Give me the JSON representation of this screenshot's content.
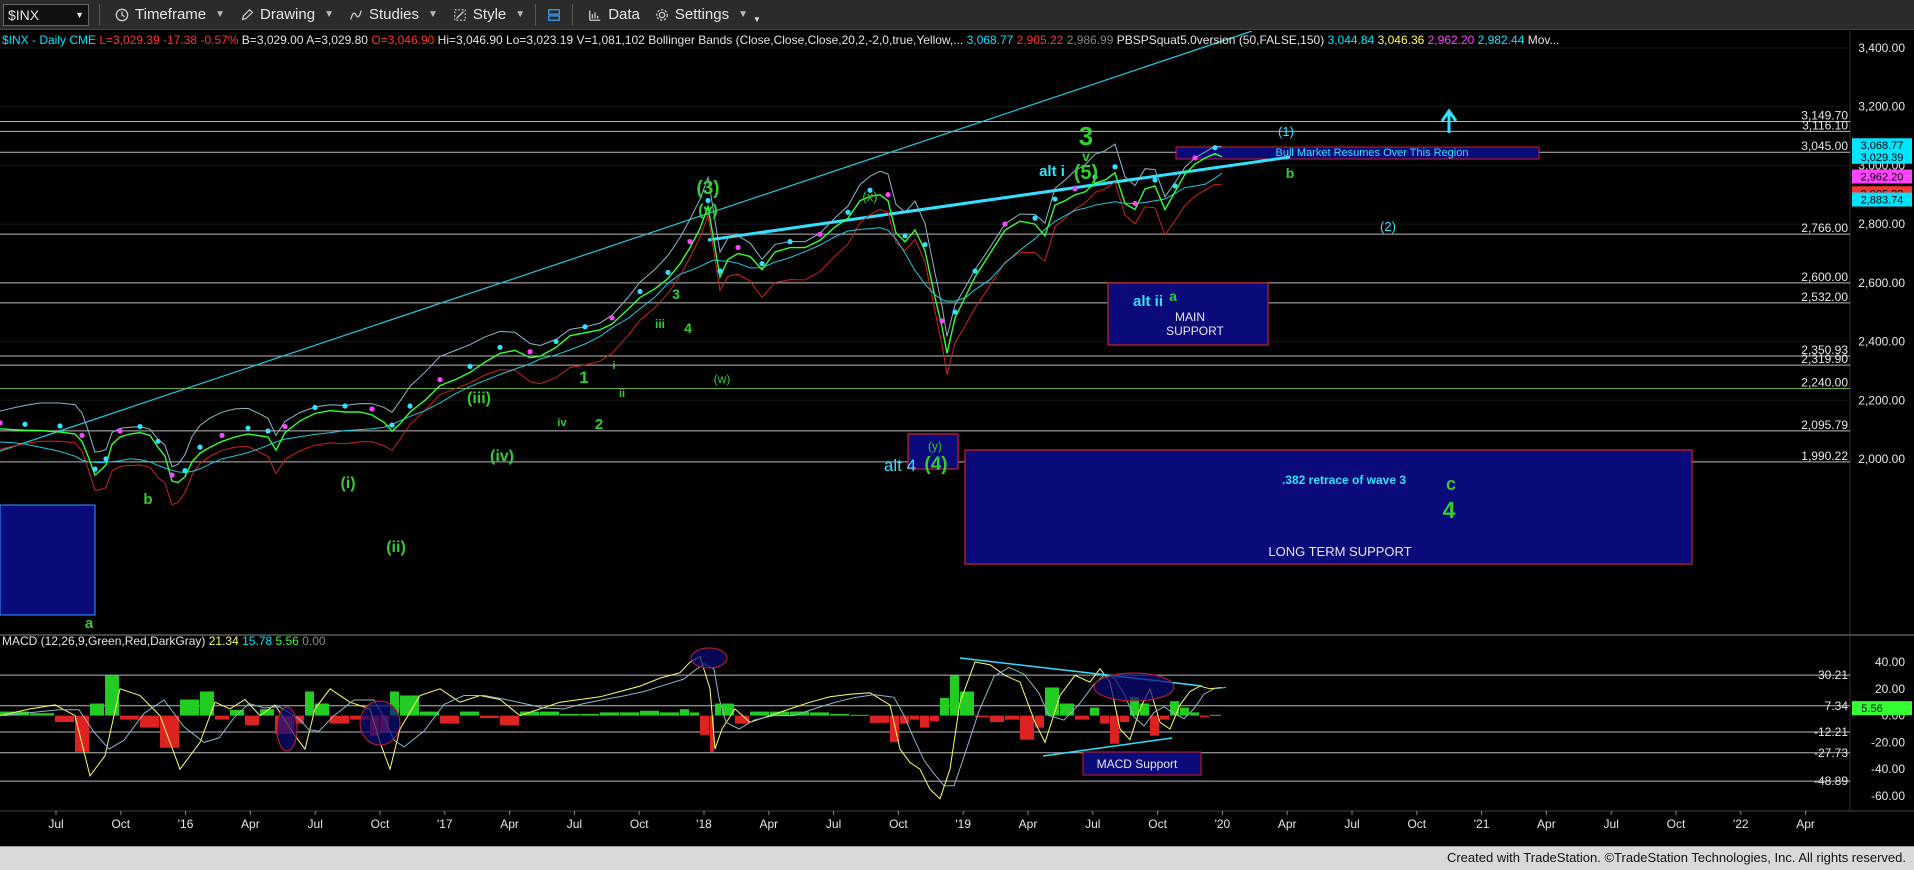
{
  "toolbar": {
    "symbol": "$INX",
    "timeframe": "Timeframe",
    "drawing": "Drawing",
    "studies": "Studies",
    "style": "Style",
    "data": "Data",
    "settings": "Settings"
  },
  "legend": {
    "items": [
      {
        "text": "$INX - Daily",
        "color": "#00e5ff"
      },
      {
        "text": "CME",
        "color": "#00e5ff"
      },
      {
        "text": "L=3,029.39",
        "color": "#ff3333"
      },
      {
        "text": "-17.38",
        "color": "#ff3333"
      },
      {
        "text": "-0.57%",
        "color": "#ff3333"
      },
      {
        "text": "B=3,029.00",
        "color": "#e6e6e6"
      },
      {
        "text": "A=3,029.80",
        "color": "#e6e6e6"
      },
      {
        "text": "O=3,046.90",
        "color": "#ff3333"
      },
      {
        "text": "Hi=3,046.90",
        "color": "#e6e6e6"
      },
      {
        "text": "Lo=3,023.19",
        "color": "#e6e6e6"
      },
      {
        "text": "V=1,081,102",
        "color": "#e6e6e6"
      },
      {
        "text": "Bollinger Bands (Close,Close,Close,20,2,-2,0,true,Yellow,...",
        "color": "#e6e6e6"
      },
      {
        "text": "3,068.77",
        "color": "#00e5ff"
      },
      {
        "text": "2,905.22",
        "color": "#ff3333"
      },
      {
        "text": "2,986.99",
        "color": "#888888"
      },
      {
        "text": "PBSPSquat5.0version (50,FALSE,150)",
        "color": "#e6e6e6"
      },
      {
        "text": "3,044.84",
        "color": "#00e5ff"
      },
      {
        "text": "3,046.36",
        "color": "#ffff66"
      },
      {
        "text": "2,962.20",
        "color": "#ff44ff"
      },
      {
        "text": "2,982.44",
        "color": "#00e5ff"
      },
      {
        "text": "Mov...",
        "color": "#e6e6e6"
      }
    ]
  },
  "macd_legend": {
    "items": [
      {
        "text": "MACD (12,26,9,Green,Red,DarkGray)",
        "color": "#e6e6e6"
      },
      {
        "text": "21.34",
        "color": "#ffff66"
      },
      {
        "text": "15.78",
        "color": "#00e5ff"
      },
      {
        "text": "5.56",
        "color": "#33ff33"
      },
      {
        "text": "0.00",
        "color": "#888888"
      }
    ]
  },
  "chart_data": {
    "type": "line",
    "title": "$INX - Daily",
    "x_labels": [
      "Jul",
      "Oct",
      "'16",
      "Apr",
      "Jul",
      "Oct",
      "'17",
      "Apr",
      "Jul",
      "Oct",
      "'18",
      "Apr",
      "Jul",
      "Oct",
      "'19",
      "Apr",
      "Jul",
      "Oct",
      "'20",
      "Apr",
      "Jul",
      "Oct",
      "'21",
      "Apr",
      "Jul",
      "Oct",
      "'22",
      "Apr"
    ],
    "ylim": [
      1880,
      3480
    ],
    "y_ticks": [
      "3,400.00",
      "3,200.00",
      "3,000.00",
      "2,800.00",
      "2,600.00",
      "2,400.00",
      "2,200.00",
      "2,000.00"
    ],
    "y_tick_values": [
      3400,
      3200,
      3000,
      2800,
      2600,
      2400,
      2200,
      2000
    ],
    "price_levels": [
      {
        "label": "3,149.70",
        "value": 3149.7
      },
      {
        "label": "3,116.10",
        "value": 3116.1
      },
      {
        "label": "3,045.00",
        "value": 3045
      },
      {
        "label": "2,766.00",
        "value": 2766
      },
      {
        "label": "2,600.00",
        "value": 2600
      },
      {
        "label": "2,532.00",
        "value": 2532
      },
      {
        "label": "2,350.93",
        "value": 2350.93
      },
      {
        "label": "2,319.90",
        "value": 2319.9
      },
      {
        "label": "2,240.00",
        "value": 2240
      },
      {
        "label": "2,095.79",
        "value": 2095.79
      },
      {
        "label": "1,990.22",
        "value": 1990.22
      }
    ],
    "price_badges": [
      {
        "label": "3,068.77",
        "value": 3068.77,
        "color": "#00e5ff"
      },
      {
        "label": "3,029.39",
        "value": 3029.39,
        "color": "#00e5ff"
      },
      {
        "label": "2,962.20",
        "value": 2962.2,
        "color": "#ff44ff"
      },
      {
        "label": "2,905.22",
        "value": 2905.22,
        "color": "#ff3333"
      },
      {
        "label": "2,883.74",
        "value": 2883.74,
        "color": "#00e5ff"
      }
    ],
    "series": [
      {
        "name": "$INX",
        "values": [
          [
            0,
            2103
          ],
          [
            12,
            2100
          ],
          [
            25,
            2098
          ],
          [
            40,
            2097
          ],
          [
            60,
            2092
          ],
          [
            75,
            2085
          ],
          [
            82,
            2060
          ],
          [
            88,
            2010
          ],
          [
            95,
            1945
          ],
          [
            100,
            1960
          ],
          [
            106,
            1980
          ],
          [
            112,
            2050
          ],
          [
            120,
            2075
          ],
          [
            130,
            2085
          ],
          [
            140,
            2090
          ],
          [
            150,
            2080
          ],
          [
            158,
            2040
          ],
          [
            165,
            2010
          ],
          [
            172,
            1925
          ],
          [
            178,
            1920
          ],
          [
            185,
            1940
          ],
          [
            192,
            1990
          ],
          [
            200,
            2020
          ],
          [
            210,
            2040
          ],
          [
            222,
            2060
          ],
          [
            235,
            2075
          ],
          [
            248,
            2085
          ],
          [
            258,
            2080
          ],
          [
            268,
            2075
          ],
          [
            276,
            2030
          ],
          [
            285,
            2090
          ],
          [
            300,
            2130
          ],
          [
            315,
            2155
          ],
          [
            330,
            2165
          ],
          [
            345,
            2160
          ],
          [
            360,
            2160
          ],
          [
            372,
            2150
          ],
          [
            384,
            2125
          ],
          [
            392,
            2095
          ],
          [
            400,
            2120
          ],
          [
            410,
            2160
          ],
          [
            425,
            2200
          ],
          [
            440,
            2250
          ],
          [
            455,
            2270
          ],
          [
            470,
            2295
          ],
          [
            485,
            2330
          ],
          [
            500,
            2360
          ],
          [
            515,
            2370
          ],
          [
            530,
            2345
          ],
          [
            540,
            2350
          ],
          [
            556,
            2380
          ],
          [
            570,
            2420
          ],
          [
            585,
            2430
          ],
          [
            600,
            2440
          ],
          [
            612,
            2460
          ],
          [
            628,
            2510
          ],
          [
            640,
            2550
          ],
          [
            655,
            2580
          ],
          [
            668,
            2615
          ],
          [
            680,
            2665
          ],
          [
            690,
            2720
          ],
          [
            700,
            2785
          ],
          [
            708,
            2860
          ],
          [
            714,
            2740
          ],
          [
            720,
            2620
          ],
          [
            728,
            2680
          ],
          [
            738,
            2700
          ],
          [
            750,
            2690
          ],
          [
            762,
            2645
          ],
          [
            775,
            2705
          ],
          [
            790,
            2720
          ],
          [
            805,
            2720
          ],
          [
            820,
            2745
          ],
          [
            835,
            2790
          ],
          [
            848,
            2820
          ],
          [
            860,
            2880
          ],
          [
            870,
            2895
          ],
          [
            880,
            2900
          ],
          [
            888,
            2880
          ],
          [
            896,
            2770
          ],
          [
            905,
            2740
          ],
          [
            915,
            2780
          ],
          [
            925,
            2710
          ],
          [
            935,
            2550
          ],
          [
            942,
            2450
          ],
          [
            947,
            2360
          ],
          [
            955,
            2480
          ],
          [
            965,
            2550
          ],
          [
            975,
            2620
          ],
          [
            990,
            2700
          ],
          [
            1005,
            2780
          ],
          [
            1020,
            2810
          ],
          [
            1035,
            2800
          ],
          [
            1045,
            2760
          ],
          [
            1055,
            2865
          ],
          [
            1065,
            2880
          ],
          [
            1075,
            2900
          ],
          [
            1085,
            2910
          ],
          [
            1095,
            2940
          ],
          [
            1105,
            2950
          ],
          [
            1115,
            2975
          ],
          [
            1125,
            2870
          ],
          [
            1135,
            2850
          ],
          [
            1145,
            2920
          ],
          [
            1155,
            2930
          ],
          [
            1165,
            2850
          ],
          [
            1175,
            2910
          ],
          [
            1185,
            2970
          ],
          [
            1195,
            3005
          ],
          [
            1205,
            3025
          ],
          [
            1215,
            3040
          ],
          [
            1222,
            3029
          ]
        ],
        "x_unit": "chart_px"
      }
    ],
    "macd": {
      "ylim": [
        -70,
        45
      ],
      "y_ticks": [
        "40.00",
        "20.00",
        "0.00",
        "-20.00",
        "-40.00",
        "-60.00"
      ],
      "y_tick_values": [
        40,
        20,
        0,
        -20,
        -40,
        -60
      ],
      "levels": [
        {
          "label": "30.21",
          "value": 30.21
        },
        {
          "label": "7.34",
          "value": 7.34
        },
        {
          "label": "-12.21",
          "value": -12.21
        },
        {
          "label": "-27.73",
          "value": -27.73
        },
        {
          "label": "-48.89",
          "value": -48.89
        }
      ],
      "badge": {
        "label": "5.56",
        "value": 5.56
      },
      "values": [
        [
          0,
          0
        ],
        [
          30,
          5
        ],
        [
          55,
          8
        ],
        [
          75,
          0
        ],
        [
          90,
          -45
        ],
        [
          105,
          -30
        ],
        [
          120,
          20
        ],
        [
          140,
          15
        ],
        [
          160,
          0
        ],
        [
          180,
          -40
        ],
        [
          200,
          -20
        ],
        [
          215,
          10
        ],
        [
          230,
          5
        ],
        [
          245,
          12
        ],
        [
          260,
          0
        ],
        [
          275,
          8
        ],
        [
          295,
          -15
        ],
        [
          305,
          -25
        ],
        [
          315,
          5
        ],
        [
          330,
          20
        ],
        [
          350,
          10
        ],
        [
          370,
          5
        ],
        [
          380,
          -20
        ],
        [
          390,
          -40
        ],
        [
          400,
          -10
        ],
        [
          420,
          15
        ],
        [
          440,
          20
        ],
        [
          460,
          10
        ],
        [
          480,
          15
        ],
        [
          500,
          12
        ],
        [
          520,
          0
        ],
        [
          540,
          5
        ],
        [
          560,
          10
        ],
        [
          580,
          12
        ],
        [
          600,
          14
        ],
        [
          620,
          18
        ],
        [
          640,
          22
        ],
        [
          660,
          28
        ],
        [
          680,
          32
        ],
        [
          690,
          40
        ],
        [
          700,
          44
        ],
        [
          710,
          20
        ],
        [
          715,
          -25
        ],
        [
          722,
          -10
        ],
        [
          735,
          5
        ],
        [
          750,
          -5
        ],
        [
          770,
          0
        ],
        [
          790,
          5
        ],
        [
          810,
          10
        ],
        [
          830,
          14
        ],
        [
          850,
          16
        ],
        [
          870,
          17
        ],
        [
          890,
          8
        ],
        [
          900,
          -25
        ],
        [
          910,
          -35
        ],
        [
          920,
          -40
        ],
        [
          930,
          -55
        ],
        [
          940,
          -62
        ],
        [
          950,
          -40
        ],
        [
          960,
          10
        ],
        [
          975,
          40
        ],
        [
          990,
          38
        ],
        [
          1005,
          30
        ],
        [
          1020,
          25
        ],
        [
          1035,
          -5
        ],
        [
          1045,
          -20
        ],
        [
          1060,
          15
        ],
        [
          1075,
          30
        ],
        [
          1090,
          25
        ],
        [
          1100,
          35
        ],
        [
          1110,
          25
        ],
        [
          1120,
          -10
        ],
        [
          1130,
          -18
        ],
        [
          1140,
          5
        ],
        [
          1150,
          20
        ],
        [
          1160,
          -5
        ],
        [
          1170,
          -10
        ],
        [
          1180,
          8
        ],
        [
          1190,
          18
        ],
        [
          1200,
          22
        ],
        [
          1210,
          20
        ],
        [
          1222,
          21
        ]
      ]
    }
  },
  "annotations": {
    "wave3_big": "3",
    "wave_v_top": "v",
    "wave_5_paren": "(5)",
    "alt_i": "alt i",
    "wave_1_paren": "(1)",
    "wave_2_paren": "(2)",
    "wave_b": "b",
    "bull_market": "Bull Market Resumes Over This Region",
    "wave_3_paren": "(3)",
    "wave_v_paren": "(v)",
    "wave_x_paren": "(x)",
    "alt_ii": "alt ii",
    "wave_a_green": "a",
    "main_support": "MAIN",
    "main_support2": "SUPPORT",
    "wave_w_paren": "(w)",
    "wave_y_paren": "(y)",
    "alt_4": "alt 4",
    "wave_4_paren": "(4)",
    "retrace": ".382 retrace of wave 3",
    "wave_c": "c",
    "wave_4_big": "4",
    "long_term_support": "LONG TERM SUPPORT",
    "wave_iii_roman": "iii",
    "wave_3_small": "3",
    "wave_4_small": "4",
    "wave_1_small": "1",
    "wave_2_small": "2",
    "wave_iii_paren": "(iii)",
    "wave_iv_paren": "(iv)",
    "wave_i_paren": "(i)",
    "wave_ii_paren": "(ii)",
    "wave_a_left": "a",
    "wave_b_left": "b",
    "macd_support": "MACD Support",
    "wave_i_small": "i",
    "wave_ii_small": "ii",
    "wave_iv_small": "iv"
  },
  "footer": "Created with TradeStation. ©TradeStation Technologies, Inc. All rights reserved."
}
